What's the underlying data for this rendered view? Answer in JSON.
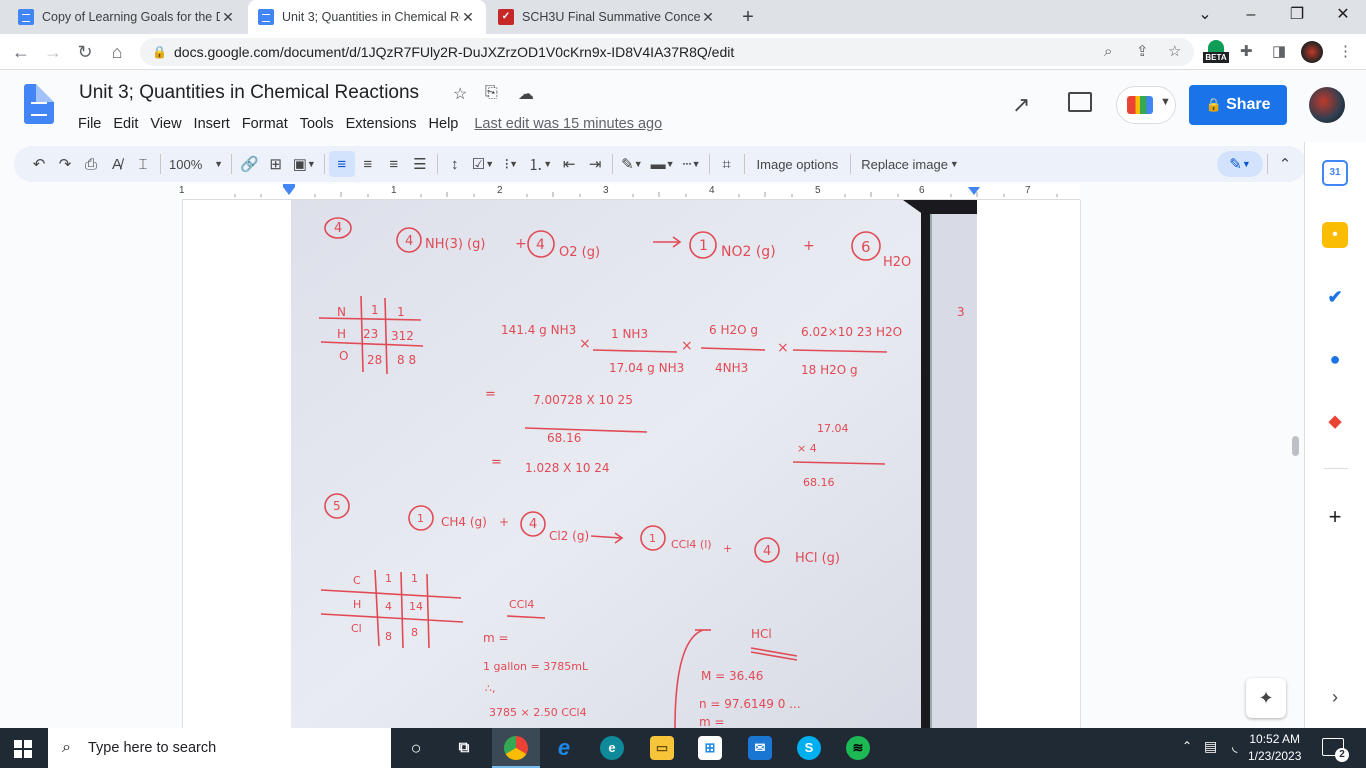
{
  "browser": {
    "tabs": [
      {
        "label": "Copy of Learning Goals for the D",
        "icon": "docs-icon",
        "active": false
      },
      {
        "label": "Unit 3; Quantities in Chemical Re",
        "icon": "docs-icon",
        "active": true
      },
      {
        "label": "SCH3U Final Summative Concept",
        "icon": "red-app-icon",
        "active": false
      }
    ],
    "close_glyph": "✕",
    "new_tab_glyph": "+",
    "url": "docs.google.com/document/d/1JQzR7FUly2R-DuJXZrzOD1V0cKrn9x-ID8V4IA37R8Q/edit",
    "beta_badge": "BETA"
  },
  "docs": {
    "title": "Unit 3; Quantities in Chemical Reactions",
    "menu": [
      "File",
      "Edit",
      "View",
      "Insert",
      "Format",
      "Tools",
      "Extensions",
      "Help"
    ],
    "last_edit": "Last edit was 15 minutes ago",
    "share_label": "Share"
  },
  "toolbar": {
    "zoom": "100%",
    "image_options": "Image options",
    "replace_image": "Replace image"
  },
  "ruler": {
    "numbers": [
      "1",
      "1",
      "2",
      "3",
      "4",
      "5",
      "6",
      "7"
    ]
  },
  "photo": {
    "q4": {
      "number": "4",
      "equation": [
        "4",
        "NH(3) (g)",
        "+",
        "4",
        "O2 (g)",
        "→",
        "1",
        "NO2 (g)",
        "+",
        "6",
        "H2O"
      ],
      "table": [
        [
          "N",
          "1",
          "1"
        ],
        [
          "H",
          "23",
          "312"
        ],
        [
          "O",
          "28",
          "8 8"
        ]
      ],
      "calc_start": "141.4 g NH3",
      "frac1": {
        "top": "1 NH3",
        "bottom": "17.04 g NH3"
      },
      "frac2": {
        "top": "6 H2O g",
        "bottom": "4NH3"
      },
      "frac3": {
        "top": "6.02×10 23 H2O",
        "bottom": "18 H2O g"
      },
      "result_num": "7.00728 X 10 25",
      "result_den": "68.16",
      "side_calc": [
        "17.04",
        "× 4",
        "68.16"
      ],
      "final": "1.028 X 10 24",
      "margin_note": "3"
    },
    "q5": {
      "number": "5",
      "equation": [
        "1",
        "CH4 (g)",
        "+",
        "4",
        "Cl2 (g)",
        "→",
        "1",
        "CCl4 (l)",
        "+",
        "4",
        "HCl (g)"
      ],
      "table": [
        [
          "C",
          "1",
          "1"
        ],
        [
          "H",
          "4",
          "14"
        ],
        [
          "Cl",
          "8",
          "8"
        ]
      ],
      "ccl4_label": "CCl4",
      "m_label": "m =",
      "gallon": "1 gallon = 3785mL",
      "therefore": "∴,",
      "bottom_calc": "3785 × 2.50 CCl4",
      "hcl_label": "HCl",
      "hcl_lines": [
        "M = 36.46",
        "n = 97.6149 0 ...",
        "m ="
      ]
    }
  },
  "taskbar": {
    "search_placeholder": "Type here to search",
    "time": "10:52 AM",
    "date": "1/23/2023",
    "notification_count": "2"
  },
  "colors": {
    "accent": "#1a73e8",
    "ink": "#e14a55",
    "taskbar": "#1f2a35"
  }
}
